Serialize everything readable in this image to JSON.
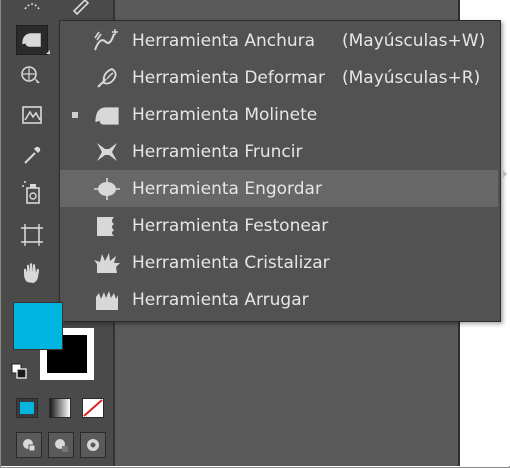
{
  "menu": {
    "items": [
      {
        "label": "Herramienta Anchura",
        "shortcut": "(Mayúsculas+W)",
        "icon": "width-tool-icon",
        "selected": false,
        "highlighted": false
      },
      {
        "label": "Herramienta Deformar",
        "shortcut": "(Mayúsculas+R)",
        "icon": "warp-tool-icon",
        "selected": false,
        "highlighted": false
      },
      {
        "label": "Herramienta Molinete",
        "shortcut": "",
        "icon": "twirl-tool-icon",
        "selected": true,
        "highlighted": false
      },
      {
        "label": "Herramienta Fruncir",
        "shortcut": "",
        "icon": "pucker-tool-icon",
        "selected": false,
        "highlighted": false
      },
      {
        "label": "Herramienta Engordar",
        "shortcut": "",
        "icon": "bloat-tool-icon",
        "selected": false,
        "highlighted": true
      },
      {
        "label": "Herramienta Festonear",
        "shortcut": "",
        "icon": "scallop-tool-icon",
        "selected": false,
        "highlighted": false
      },
      {
        "label": "Herramienta Cristalizar",
        "shortcut": "",
        "icon": "crystallize-tool-icon",
        "selected": false,
        "highlighted": false
      },
      {
        "label": "Herramienta Arrugar",
        "shortcut": "",
        "icon": "wrinkle-tool-icon",
        "selected": false,
        "highlighted": false
      }
    ]
  },
  "colors": {
    "fill": "#00b6e0",
    "stroke": "#000000",
    "toolbar_bg": "#4a4a4a",
    "menu_bg": "#525252",
    "highlight_bg": "#676767"
  }
}
